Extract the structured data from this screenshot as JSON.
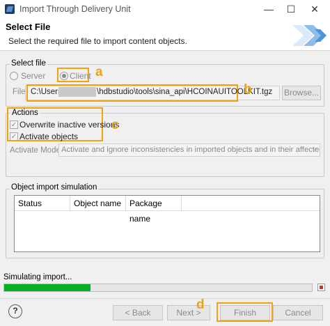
{
  "window": {
    "title": "Import Through Delivery Unit",
    "minimize_glyph": "—",
    "maximize_glyph": "☐",
    "close_glyph": "✕"
  },
  "header": {
    "title": "Select File",
    "description": "Select the required file to import content objects."
  },
  "select_file": {
    "group_label": "Select file",
    "server_label": "Server",
    "client_label": "Client",
    "selected": "Client",
    "file_label": "File:",
    "file_path_prefix": "C:\\Users\\",
    "file_path_suffix": "\\hdbstudio\\tools\\sina_api\\HCOINAUITOOLKIT.tgz",
    "browse_label": "Browse..."
  },
  "actions": {
    "group_label": "Actions",
    "overwrite_label": "Overwrite inactive versions",
    "overwrite_checked": true,
    "activate_label": "Activate objects",
    "activate_checked": true,
    "activate_mode_label": "Activate Mode:",
    "activate_mode_value": "Activate and ignore inconsistencies in imported objects and in their affected objects"
  },
  "simulation": {
    "group_label": "Object import simulation",
    "columns": [
      "Status",
      "Object name",
      "Package name"
    ],
    "rows": []
  },
  "status": {
    "text": "Simulating import...",
    "progress": 0.28,
    "progress_color": "#06b025",
    "stop_color": "#c0392b"
  },
  "footer": {
    "help_glyph": "?",
    "back_label": "< Back",
    "next_label": "Next >",
    "finish_label": "Finish",
    "cancel_label": "Cancel"
  },
  "annotations": {
    "a": "a",
    "b": "b",
    "c": "c",
    "d": "d",
    "color": "#f0a30a"
  }
}
